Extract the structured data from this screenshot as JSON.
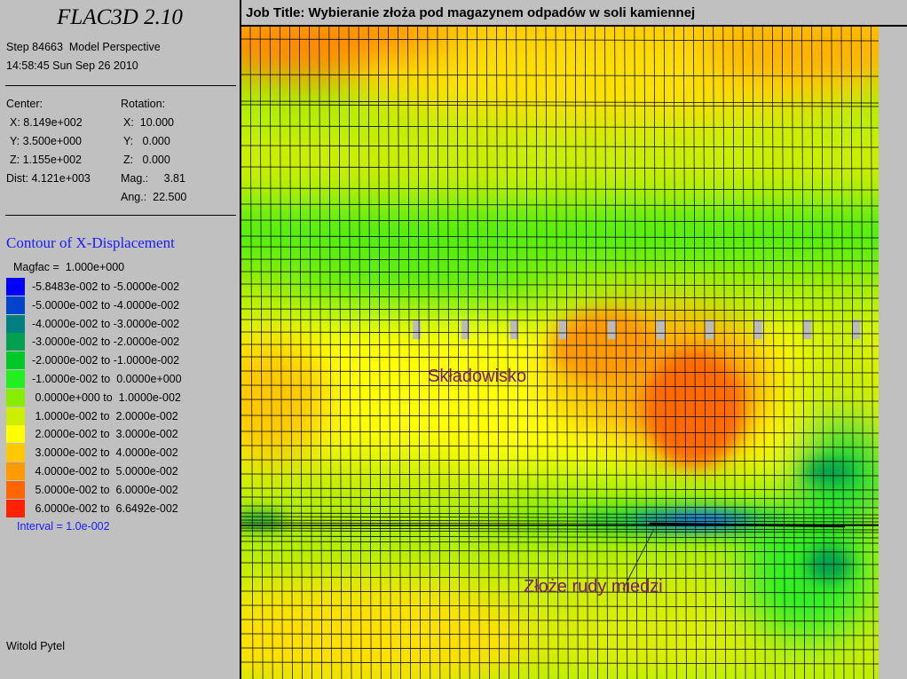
{
  "app_title": "FLAC3D 2.10",
  "step_line": "Step 84663  Model Perspective",
  "timestamp": "14:58:45 Sun Sep 26 2010",
  "view": {
    "center_label": "Center:",
    "center_x": "X: 8.149e+002",
    "center_y": "Y: 3.500e+000",
    "center_z": "Z: 1.155e+002",
    "dist": "Dist: 4.121e+003",
    "rotation_label": "Rotation:",
    "rot_x": "X:  10.000",
    "rot_y": "Y:   0.000",
    "rot_z": "Z:   0.000",
    "mag": "Mag.:     3.81",
    "ang": "Ang.:  22.500"
  },
  "contour": {
    "title": "Contour of X-Displacement",
    "magfac": "Magfac =  1.000e+000",
    "interval": "Interval =  1.0e-002",
    "legend": [
      {
        "label": "-5.8483e-002 to -5.0000e-002",
        "color": "#0000ff"
      },
      {
        "label": "-5.0000e-002 to -4.0000e-002",
        "color": "#0044cc"
      },
      {
        "label": "-4.0000e-002 to -3.0000e-002",
        "color": "#008080"
      },
      {
        "label": "-3.0000e-002 to -2.0000e-002",
        "color": "#00a050"
      },
      {
        "label": "-2.0000e-002 to -1.0000e-002",
        "color": "#00c828"
      },
      {
        "label": "-1.0000e-002 to  0.0000e+000",
        "color": "#22ee22"
      },
      {
        "label": " 0.0000e+000 to  1.0000e-002",
        "color": "#88ee00"
      },
      {
        "label": " 1.0000e-002 to  2.0000e-002",
        "color": "#ccee00"
      },
      {
        "label": " 2.0000e-002 to  3.0000e-002",
        "color": "#ffff00"
      },
      {
        "label": " 3.0000e-002 to  4.0000e-002",
        "color": "#ffc800"
      },
      {
        "label": " 4.0000e-002 to  5.0000e-002",
        "color": "#ff9a00"
      },
      {
        "label": " 5.0000e-002 to  6.0000e-002",
        "color": "#ff6600"
      },
      {
        "label": " 6.0000e-002 to  6.6492e-002",
        "color": "#ff2200"
      }
    ]
  },
  "author": "Witold Pytel",
  "job_title": "Job Title: Wybieranie złoża pod magazynem odpadów w soli kamiennej",
  "annotations": {
    "storage": "Składowisko",
    "ore": "Złoże rudy miedzi"
  },
  "colors": {
    "label_purple": "#7a1a7a",
    "title_blue": "#1a1aff"
  }
}
